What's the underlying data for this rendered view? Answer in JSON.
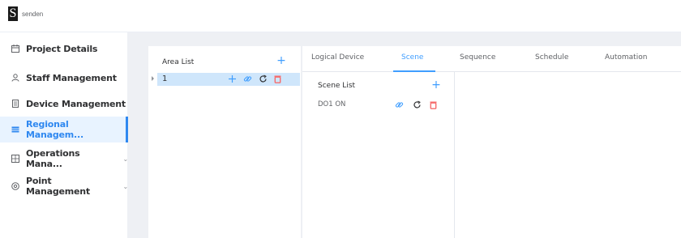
{
  "brand": {
    "logo_letter": "S",
    "logo_text": "senden"
  },
  "sidebar": {
    "items": [
      {
        "label": "Project Details",
        "icon": "calendar-icon",
        "active": false,
        "has_submenu": false
      },
      {
        "label": "Staff Management",
        "icon": "user-icon",
        "active": false,
        "has_submenu": false
      },
      {
        "label": "Device Management",
        "icon": "document-icon",
        "active": false,
        "has_submenu": false
      },
      {
        "label": "Regional Managem...",
        "icon": "region-icon",
        "active": true,
        "has_submenu": false
      },
      {
        "label": "Operations Mana...",
        "icon": "grid-icon",
        "active": false,
        "has_submenu": true
      },
      {
        "label": "Point Management",
        "icon": "location-icon",
        "active": false,
        "has_submenu": true
      }
    ],
    "chevron": "⌄"
  },
  "area_panel": {
    "title": "Area List",
    "add_icon": "+",
    "rows": [
      {
        "name": "1",
        "selected": true
      }
    ]
  },
  "tabs": {
    "items": [
      {
        "label": "Logical Device",
        "active": false
      },
      {
        "label": "Scene",
        "active": true
      },
      {
        "label": "Sequence",
        "active": false
      },
      {
        "label": "Schedule",
        "active": false
      },
      {
        "label": "Automation",
        "active": false
      }
    ]
  },
  "scene_panel": {
    "title": "Scene List",
    "add_icon": "+",
    "rows": [
      {
        "name": "DO1 ON"
      }
    ]
  },
  "colors": {
    "accent": "#409eff",
    "active_nav": "#2f88f0",
    "selected_row": "#cfe6fb",
    "delete": "#f56c6c",
    "content_bg": "#eef0f4"
  }
}
